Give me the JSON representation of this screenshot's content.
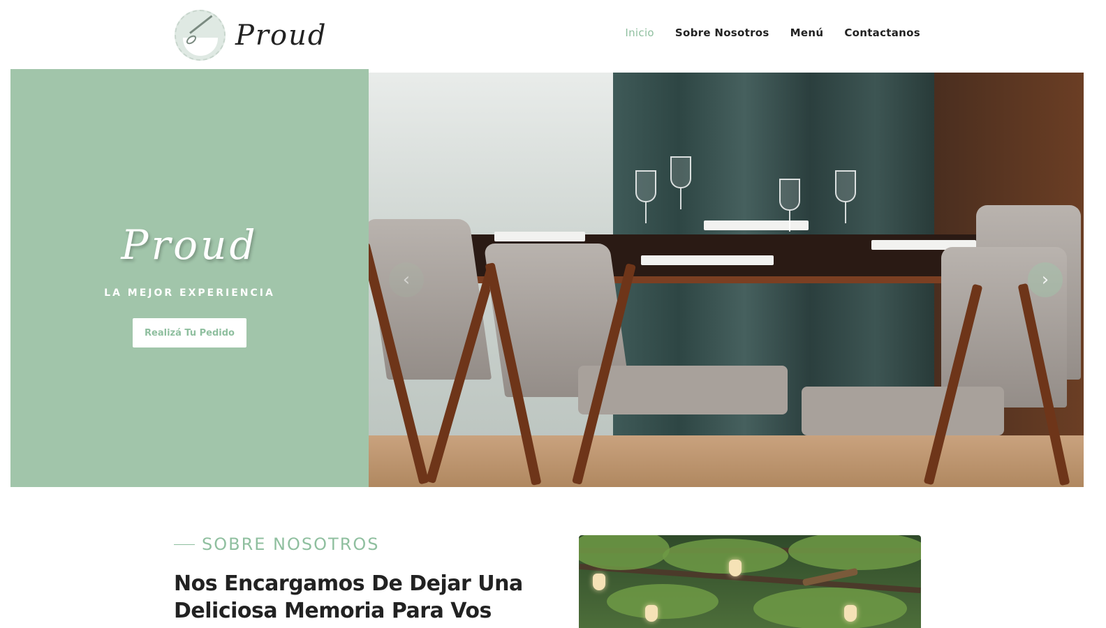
{
  "header": {
    "logo_text": "Proud",
    "nav": [
      {
        "label": "Inicio",
        "active": true
      },
      {
        "label": "Sobre Nosotros",
        "active": false
      },
      {
        "label": "Menú",
        "active": false
      },
      {
        "label": "Contactanos",
        "active": false
      }
    ]
  },
  "hero": {
    "script_title": "Proud",
    "tagline": "LA MEJOR EXPERIENCIA",
    "cta_label": "Realizá Tu Pedido",
    "prev_arrow": "‹",
    "next_arrow": "›"
  },
  "about": {
    "eyebrow": "SOBRE NOSOTROS",
    "heading": "Nos Encargamos De Dejar Una Deliciosa Memoria Para Vos"
  },
  "colors": {
    "accent": "#a1c5aa",
    "accent_text": "#8fbf9f",
    "text": "#222222"
  },
  "icons": {
    "logo": "whisk-bowl-icon",
    "prev": "chevron-left-icon",
    "next": "chevron-right-icon"
  }
}
